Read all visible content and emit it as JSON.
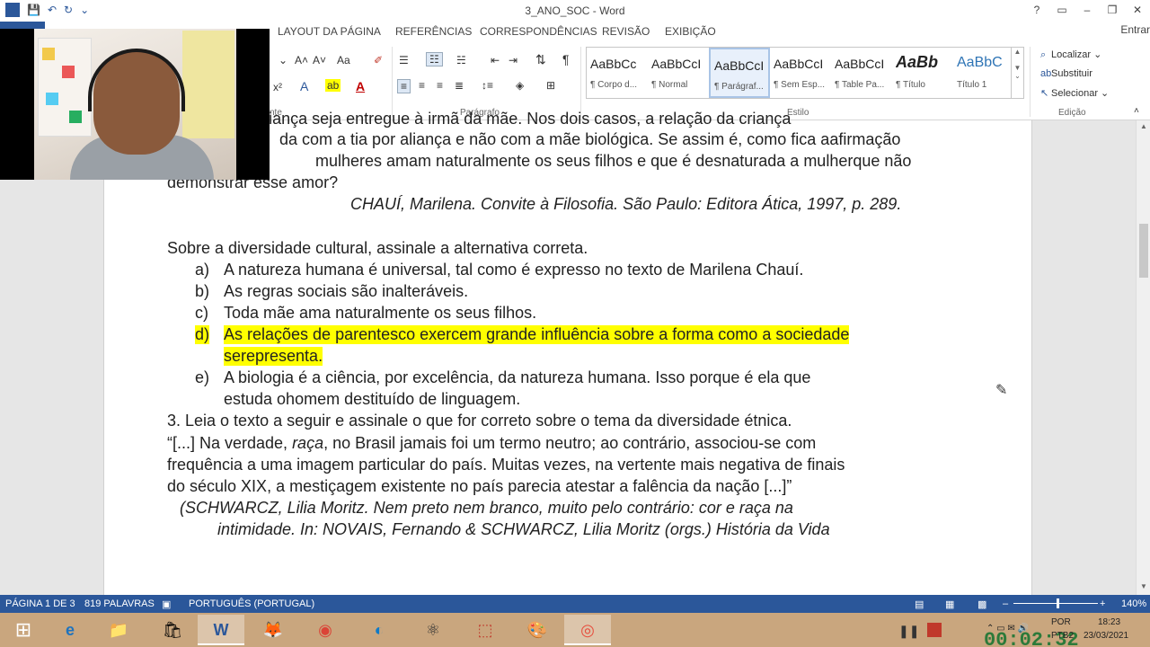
{
  "window": {
    "title": "3_ANO_SOC - Word",
    "controls": [
      "?",
      "▭",
      "–",
      "❐",
      "✕"
    ],
    "signin": "Entrar"
  },
  "qat": {
    "word_logo": "W",
    "save": "💾",
    "undo": "↶",
    "redo": "↻",
    "customize": "⌄"
  },
  "tabs": [
    "LAYOUT DA PÁGINA",
    "REFERÊNCIAS",
    "CORRESPONDÊNCIAS",
    "REVISÃO",
    "EXIBIÇÃO"
  ],
  "ribbon": {
    "font_grow": "A˄",
    "font_shrink": "A˅",
    "change_case": "Aa",
    "clear_format": "✐",
    "superscript": "x²",
    "font_effects": "A",
    "highlight": "ab",
    "font_color": "A",
    "font_group_label": "nte",
    "paragraph_group_label": "Parágrafo",
    "styles_group_label": "Estilo",
    "edit_group_label": "Edição",
    "pilcrow": "¶",
    "sort": "⇅",
    "styles": [
      {
        "sample": "AaBbCc",
        "name": "¶ Corpo d..."
      },
      {
        "sample": "AaBbCcI",
        "name": "¶ Normal"
      },
      {
        "sample": "AaBbCcI",
        "name": "¶ Parágraf..."
      },
      {
        "sample": "AaBbCcI",
        "name": "¶ Sem Esp..."
      },
      {
        "sample": "AaBbCcI",
        "name": "¶ Table Pa..."
      },
      {
        "sample": "AaBb",
        "name": "¶ Título"
      },
      {
        "sample": "AaBbC",
        "name": "Título 1"
      }
    ],
    "edit": {
      "find": "Localizar",
      "replace": "Substituir",
      "select": "Selecionar"
    }
  },
  "document": {
    "lines": {
      "l0a": "exige que a criança seja entregue à irmã da mãe. Nos dois casos, a relação da criança",
      "l1a": "da com a tia por aliança e não com a mãe biológica. Se assim é, como fica aafirmação",
      "l2a": "mulheres amam naturalmente os seus filhos e que é desnaturada a mulherque não",
      "l3a": "demonstrar esse amor?",
      "citation": "CHAUÍ, Marilena. Convite à Filosofia. São Paulo: Editora Ática, 1997, p. 289.",
      "question": "Sobre a diversidade cultural, assinale a alternativa correta.",
      "opt_a_letter": "a)",
      "opt_a": "A natureza humana é universal, tal como é expresso no texto de Marilena Chauí.",
      "opt_b_letter": "b)",
      "opt_b": "As regras sociais são inalteráveis.",
      "opt_c_letter": "c)",
      "opt_c": "Toda mãe ama naturalmente os seus filhos.",
      "opt_d_letter": "d)",
      "opt_d1": "As relações de parentesco exercem grande influência sobre a forma como a sociedade",
      "opt_d2": "serepresenta.",
      "opt_e_letter": "e)",
      "opt_e1": "A biologia é a ciência, por excelência, da natureza humana. Isso porque é ela que",
      "opt_e2": "estuda ohomem destituído de linguagem.",
      "q3": "3. Leia o texto a seguir e assinale o que for correto sobre o tema da diversidade étnica.",
      "quote1_pre": "“[...] Na verdade, ",
      "quote1_ital": "raça",
      "quote1_post": ", no Brasil jamais foi um termo neutro; ao contrário, associou-se com",
      "quote2": "frequência a uma imagem particular do país. Muitas vezes, na vertente mais negativa de finais",
      "quote3": "do século XIX, a mestiçagem existente no país parecia atestar a falência da nação [...]”",
      "ref1": "(SCHWARCZ, Lilia Moritz. Nem preto nem branco, muito pelo contrário: cor e raça na",
      "ref2": "intimidade. In: NOVAIS, Fernando & SCHWARCZ, Lilia Moritz (orgs.) História da Vida"
    }
  },
  "status": {
    "page": "PÁGINA 1 DE 3",
    "words": "819 PALAVRAS",
    "language": "PORTUGUÊS (PORTUGAL)",
    "zoom": "140%",
    "zoom_minus": "–",
    "zoom_plus": "+"
  },
  "taskbar": {
    "start": "⊞",
    "apps": [
      "e",
      "📁",
      "🛍",
      "W",
      "🦊",
      "◉",
      "◐",
      "⚛",
      "⬚",
      "🎨",
      "◎"
    ],
    "lang": "POR",
    "kbd": "PTB2",
    "time": "18:23",
    "date": "23/03/2021",
    "timer": "00:02:32"
  },
  "colors": {
    "word_blue": "#2b579a",
    "highlight": "#ffff00",
    "taskbar": "#c9a67e"
  }
}
